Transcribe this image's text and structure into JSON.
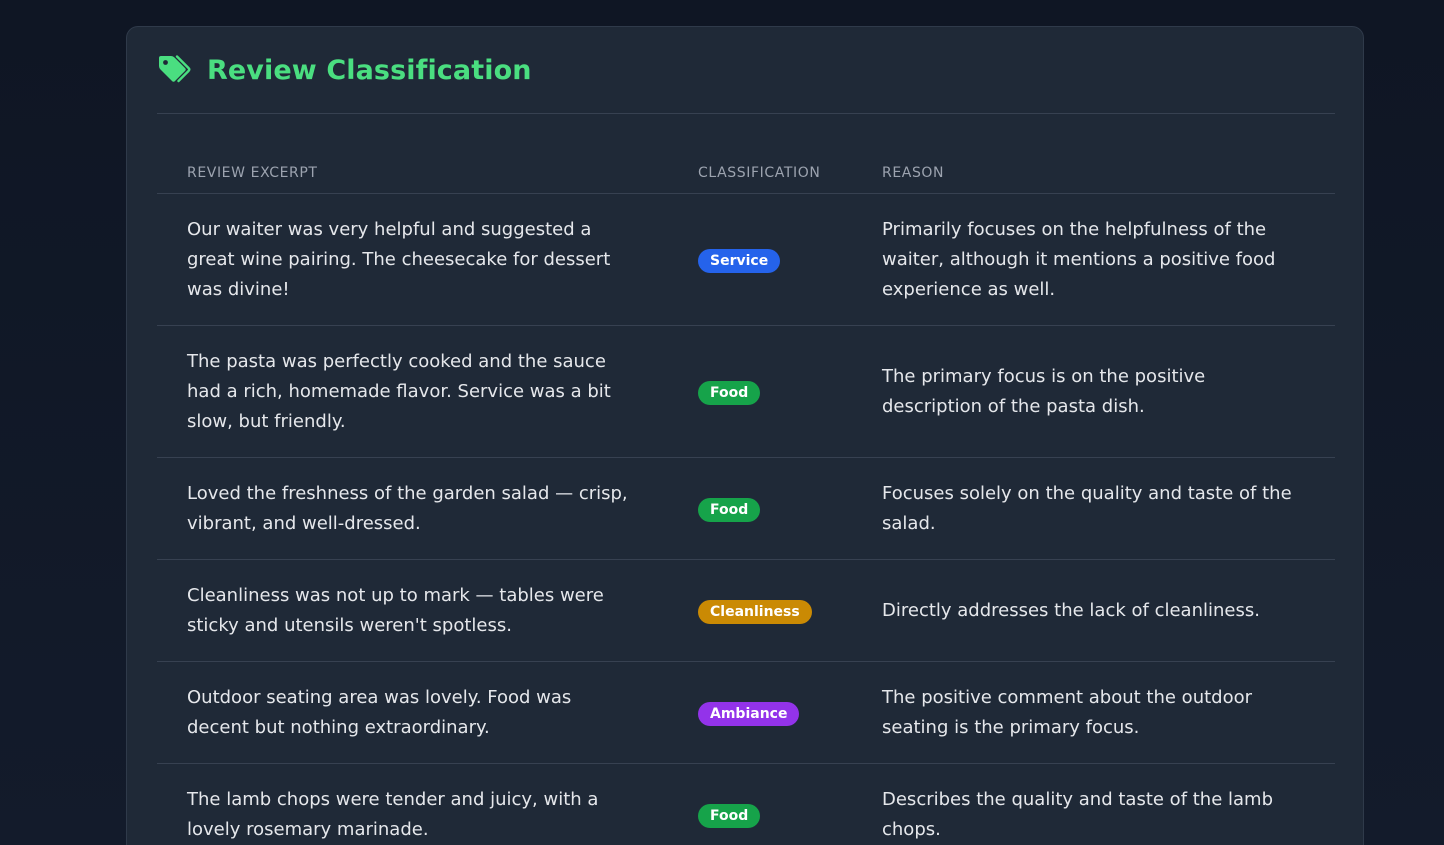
{
  "header": {
    "title": "Review Classification",
    "icon": "tag-icon"
  },
  "table": {
    "columns": [
      "Review Excerpt",
      "Classification",
      "Reason"
    ],
    "rows": [
      {
        "excerpt": "Our waiter was very helpful and suggested a great wine pairing. The cheesecake for dessert was divine!",
        "classification": "Service",
        "badge_color": "#2563eb",
        "reason": "Primarily focuses on the helpfulness of the waiter, although it mentions a positive food experience as well."
      },
      {
        "excerpt": "The pasta was perfectly cooked and the sauce had a rich, homemade flavor. Service was a bit slow, but friendly.",
        "classification": "Food",
        "badge_color": "#16a34a",
        "reason": "The primary focus is on the positive description of the pasta dish."
      },
      {
        "excerpt": "Loved the freshness of the garden salad — crisp, vibrant, and well-dressed.",
        "classification": "Food",
        "badge_color": "#16a34a",
        "reason": "Focuses solely on the quality and taste of the salad."
      },
      {
        "excerpt": "Cleanliness was not up to mark — tables were sticky and utensils weren't spotless.",
        "classification": "Cleanliness",
        "badge_color": "#ca8a04",
        "reason": "Directly addresses the lack of cleanliness."
      },
      {
        "excerpt": "Outdoor seating area was lovely. Food was decent but nothing extraordinary.",
        "classification": "Ambiance",
        "badge_color": "#9333ea",
        "reason": "The positive comment about the outdoor seating is the primary focus."
      },
      {
        "excerpt": "The lamb chops were tender and juicy, with a lovely rosemary marinade.",
        "classification": "Food",
        "badge_color": "#16a34a",
        "reason": "Describes the quality and taste of the lamb chops."
      }
    ]
  },
  "colors": {
    "accent": "#4ade80",
    "card_bg": "#1f2937",
    "page_bg": "#111827"
  }
}
